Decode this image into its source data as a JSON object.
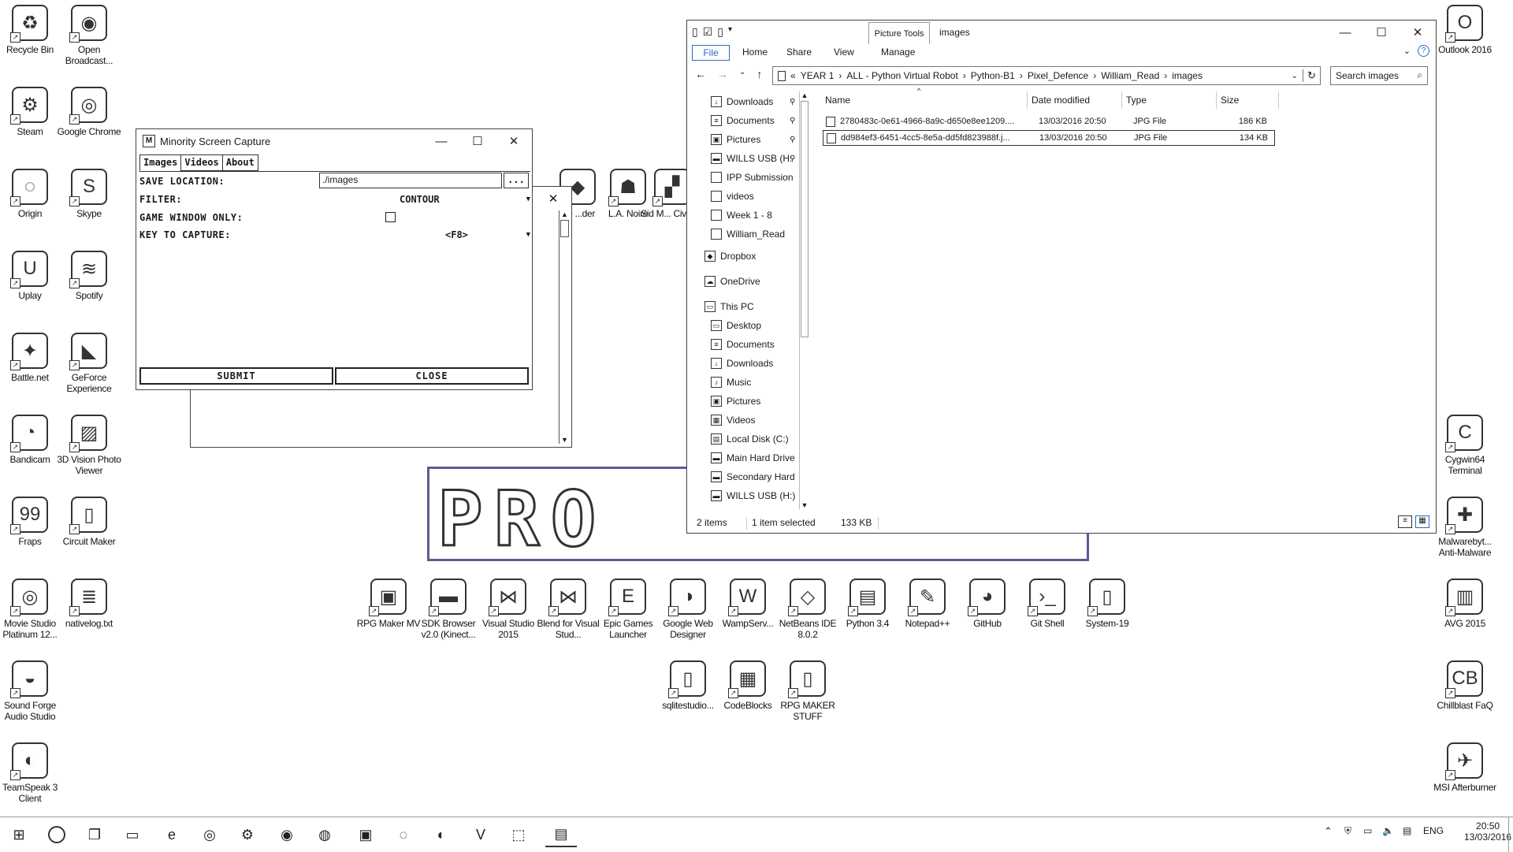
{
  "desktop_icons": [
    {
      "label": "Recycle Bin",
      "icon": "recycle-bin-icon"
    },
    {
      "label": "Open Broadcast...",
      "icon": "obs-icon"
    },
    {
      "label": "Steam",
      "icon": "steam-icon"
    },
    {
      "label": "Google Chrome",
      "icon": "chrome-icon"
    },
    {
      "label": "Origin",
      "icon": "origin-icon"
    },
    {
      "label": "Skype",
      "icon": "skype-icon"
    },
    {
      "label": "Uplay",
      "icon": "uplay-icon"
    },
    {
      "label": "Spotify",
      "icon": "spotify-icon"
    },
    {
      "label": "Battle.net",
      "icon": "battlenet-icon"
    },
    {
      "label": "GeForce Experience",
      "icon": "geforce-icon"
    },
    {
      "label": "Bandicam",
      "icon": "bandicam-icon"
    },
    {
      "label": "3D Vision Photo Viewer",
      "icon": "3d-vision-icon"
    },
    {
      "label": "Fraps",
      "icon": "fraps-icon"
    },
    {
      "label": "Circuit Maker",
      "icon": "circuit-maker-icon"
    },
    {
      "label": "Movie Studio Platinum 12...",
      "icon": "movie-studio-icon"
    },
    {
      "label": "nativelog.txt",
      "icon": "text-file-icon"
    },
    {
      "label": "Sound Forge Audio Studio",
      "icon": "sound-forge-icon"
    },
    {
      "label": "TeamSpeak 3 Client",
      "icon": "teamspeak-icon"
    },
    {
      "label": "L.A. Noire",
      "icon": "la-noire-icon"
    },
    {
      "label": "Sid M... Civiliz...",
      "icon": "civilization-icon"
    },
    {
      "label": "...e ...der",
      "icon": "game-icon"
    },
    {
      "label": "Outlook 2016",
      "icon": "outlook-icon"
    },
    {
      "label": "Cygwin64 Terminal",
      "icon": "cygwin-icon"
    },
    {
      "label": "Malwarebyt... Anti-Malware",
      "icon": "malwarebytes-icon"
    },
    {
      "label": "AVG 2015",
      "icon": "avg-icon"
    },
    {
      "label": "Chillblast FaQ",
      "icon": "chillblast-icon"
    },
    {
      "label": "MSI Afterburner",
      "icon": "msi-afterburner-icon"
    },
    {
      "label": "RPG Maker MV",
      "icon": "rpg-maker-icon"
    },
    {
      "label": "SDK Browser v2.0 (Kinect...",
      "icon": "sdk-browser-icon"
    },
    {
      "label": "Visual Studio 2015",
      "icon": "visual-studio-icon"
    },
    {
      "label": "Blend for Visual Stud...",
      "icon": "blend-icon"
    },
    {
      "label": "Epic Games Launcher",
      "icon": "epic-games-icon"
    },
    {
      "label": "Google Web Designer",
      "icon": "web-designer-icon"
    },
    {
      "label": "WampServ...",
      "icon": "wampserver-icon"
    },
    {
      "label": "NetBeans IDE 8.0.2",
      "icon": "netbeans-icon"
    },
    {
      "label": "Python 3.4",
      "icon": "python-icon"
    },
    {
      "label": "Notepad++",
      "icon": "notepadpp-icon"
    },
    {
      "label": "GitHub",
      "icon": "github-icon"
    },
    {
      "label": "Git Shell",
      "icon": "git-shell-icon"
    },
    {
      "label": "System-19",
      "icon": "folder-icon"
    },
    {
      "label": "sqlitestudio...",
      "icon": "folder-icon"
    },
    {
      "label": "CodeBlocks",
      "icon": "codeblocks-icon"
    },
    {
      "label": "RPG MAKER STUFF",
      "icon": "folder-icon"
    }
  ],
  "capture_window": {
    "title": "Minority Screen Capture",
    "tabs": [
      "Images",
      "Videos",
      "About"
    ],
    "save_location_label": "SAVE LOCATION:",
    "save_location_value": "./images",
    "browse_label": "...",
    "filter_label": "FILTER:",
    "filter_value": "CONTOUR",
    "game_window_label": "GAME WINDOW ONLY:",
    "key_label": "KEY TO CAPTURE:",
    "key_value": "<F8>",
    "submit_label": "SUBMIT",
    "close_label": "CLOSE",
    "logo_glyph": "M"
  },
  "explorer": {
    "context_tab": "Picture Tools",
    "title": "images",
    "ribbon_tabs": [
      "File",
      "Home",
      "Share",
      "View",
      "Manage"
    ],
    "breadcrumb": [
      "«",
      "YEAR 1",
      "ALL - Python Virtual Robot",
      "Python-B1",
      "Pixel_Defence",
      "William_Read",
      "images"
    ],
    "search_placeholder": "Search images",
    "nav_items": [
      {
        "label": "Downloads",
        "pinned": true
      },
      {
        "label": "Documents",
        "pinned": true
      },
      {
        "label": "Pictures",
        "pinned": true
      },
      {
        "label": "WILLS USB (H:",
        "pinned": true
      },
      {
        "label": "IPP Submission"
      },
      {
        "label": "videos"
      },
      {
        "label": "Week 1 - 8"
      },
      {
        "label": "William_Read"
      },
      {
        "label": "Dropbox"
      },
      {
        "label": "OneDrive"
      },
      {
        "label": "This PC"
      },
      {
        "label": "Desktop"
      },
      {
        "label": "Documents"
      },
      {
        "label": "Downloads"
      },
      {
        "label": "Music"
      },
      {
        "label": "Pictures"
      },
      {
        "label": "Videos"
      },
      {
        "label": "Local Disk (C:)"
      },
      {
        "label": "Main Hard Drive"
      },
      {
        "label": "Secondary Hard"
      },
      {
        "label": "WILLS USB (H:)"
      }
    ],
    "columns": [
      "Name",
      "Date modified",
      "Type",
      "Size"
    ],
    "files": [
      {
        "name": "2780483c-0e61-4966-8a9c-d650e8ee1209....",
        "date": "13/03/2016 20:50",
        "type": "JPG File",
        "size": "186 KB"
      },
      {
        "name": "dd984ef3-6451-4cc5-8e5a-dd5fd823988f.j...",
        "date": "13/03/2016 20:50",
        "type": "JPG File",
        "size": "134 KB"
      }
    ],
    "status_items": "2 items",
    "status_selected": "1 item selected",
    "status_size": "133 KB"
  },
  "logo_text": "PRO",
  "taskbar": {
    "language": "ENG",
    "time": "20:50",
    "date": "13/03/2016"
  }
}
